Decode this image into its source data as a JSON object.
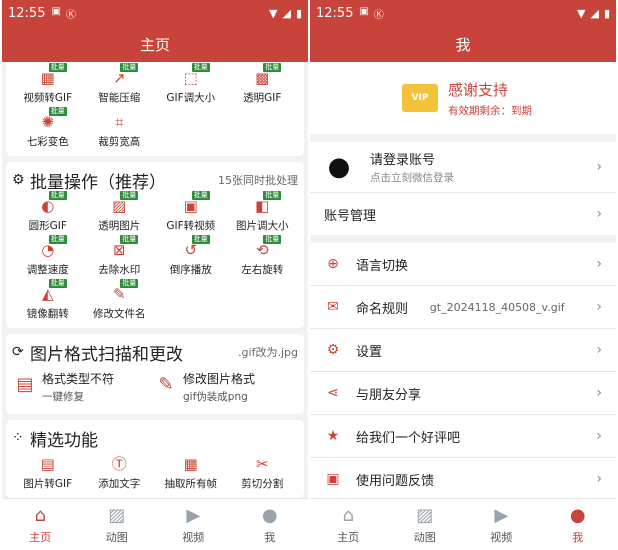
{
  "status_bar": {
    "time": "12:55"
  },
  "left": {
    "title": "主页",
    "top_tools": [
      {
        "label": "视频转GIF",
        "icon": "video-gif-icon",
        "badge": "批量"
      },
      {
        "label": "智能压缩",
        "icon": "compress-icon",
        "badge": "批量"
      },
      {
        "label": "GIF调大小",
        "icon": "resize-icon",
        "badge": "批量"
      },
      {
        "label": "透明GIF",
        "icon": "transparent-icon",
        "badge": "批量"
      },
      {
        "label": "七彩变色",
        "icon": "color-wheel-icon",
        "badge": "批量"
      },
      {
        "label": "裁剪宽高",
        "icon": "crop-icon",
        "badge": ""
      }
    ],
    "batch": {
      "title": "批量操作（推荐）",
      "subtitle": "15张同时批处理",
      "tools": [
        {
          "label": "圆形GIF",
          "icon": "circle-icon",
          "badge": "批量"
        },
        {
          "label": "透明图片",
          "icon": "transparent-image-icon",
          "badge": "批量"
        },
        {
          "label": "GIF转视频",
          "icon": "gif-video-icon",
          "badge": "批量"
        },
        {
          "label": "图片调大小",
          "icon": "image-resize-icon",
          "badge": "批量"
        },
        {
          "label": "调整速度",
          "icon": "speed-icon",
          "badge": "批量"
        },
        {
          "label": "去除水印",
          "icon": "watermark-icon",
          "badge": "批量"
        },
        {
          "label": "倒序播放",
          "icon": "reverse-icon",
          "badge": "批量"
        },
        {
          "label": "左右旋转",
          "icon": "rotate-icon",
          "badge": "批量"
        },
        {
          "label": "镜像翻转",
          "icon": "mirror-icon",
          "badge": "批量"
        },
        {
          "label": "修改文件名",
          "icon": "rename-icon",
          "badge": "批量"
        }
      ]
    },
    "format": {
      "title": "图片格式扫描和更改",
      "subtitle": ".gif改为.jpg",
      "items": [
        {
          "main": "格式类型不符",
          "sub": "一键修复",
          "icon": "file-fix-icon"
        },
        {
          "main": "修改图片格式",
          "sub": "gif伪装成png",
          "icon": "edit-format-icon"
        }
      ]
    },
    "featured": {
      "title": "精选功能",
      "tools": [
        {
          "label": "图片转GIF",
          "icon": "images-gif-icon"
        },
        {
          "label": "添加文字",
          "icon": "text-icon"
        },
        {
          "label": "抽取所有帧",
          "icon": "frames-icon"
        },
        {
          "label": "剪切分割",
          "icon": "scissors-icon"
        }
      ]
    }
  },
  "right": {
    "title": "我",
    "vip": {
      "badge": "VIP",
      "thanks": "感谢支持",
      "expiry": "有效期剩余：到期"
    },
    "login": {
      "title": "请登录账号",
      "subtitle": "点击立刻微信登录"
    },
    "account": "账号管理",
    "settings": [
      {
        "label": "语言切换",
        "icon": "globe-icon",
        "value": ""
      },
      {
        "label": "命名规则",
        "icon": "naming-icon",
        "value": "gt_2024118_40508_v.gif"
      },
      {
        "label": "设置",
        "icon": "settings-icon",
        "value": ""
      },
      {
        "label": "与朋友分享",
        "icon": "share-icon",
        "value": ""
      },
      {
        "label": "给我们一个好评吧",
        "icon": "star-icon",
        "value": ""
      },
      {
        "label": "使用问题反馈",
        "icon": "feedback-icon",
        "value": ""
      }
    ]
  },
  "tabs": [
    {
      "label": "主页",
      "icon": "home-icon"
    },
    {
      "label": "动图",
      "icon": "gif-image-icon"
    },
    {
      "label": "视频",
      "icon": "video-icon"
    },
    {
      "label": "我",
      "icon": "person-icon"
    }
  ],
  "colors": {
    "accent": "#c8443a",
    "badge": "#2e8b3a"
  }
}
